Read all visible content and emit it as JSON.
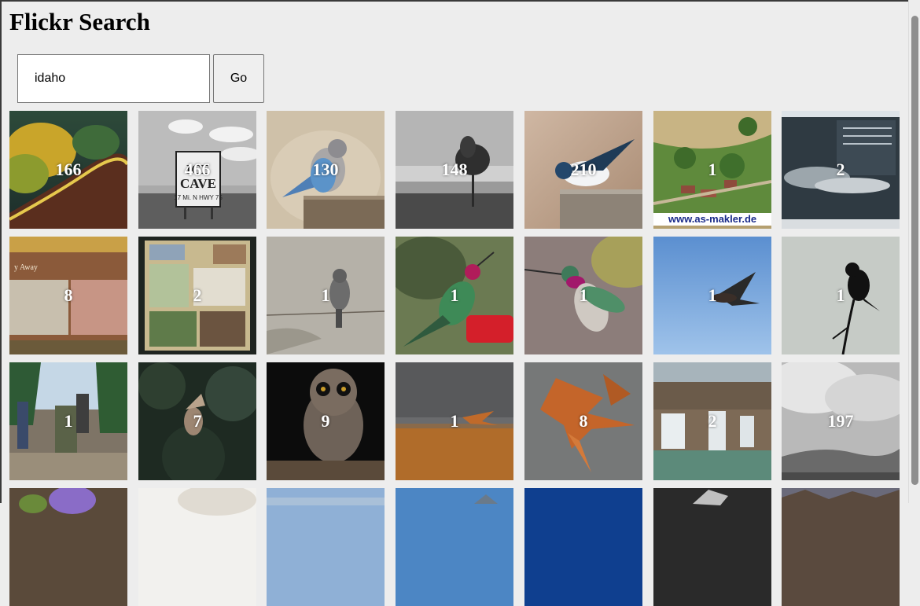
{
  "page": {
    "title": "Flickr Search"
  },
  "search": {
    "value": "idaho",
    "go_label": "Go"
  },
  "results": [
    {
      "count": "166",
      "photo": "autumn-trees-hillside"
    },
    {
      "count": "466",
      "photo": "ice-cave-sign"
    },
    {
      "count": "130",
      "photo": "bluebird-on-post"
    },
    {
      "count": "148",
      "photo": "lone-tree-monochrome"
    },
    {
      "count": "210",
      "photo": "swallow-on-post"
    },
    {
      "count": "1",
      "photo": "aerial-farm",
      "caption": "www.as-makler.de"
    },
    {
      "count": "2",
      "photo": "pass-sign"
    },
    {
      "count": "8",
      "photo": "interpretive-sign"
    },
    {
      "count": "2",
      "photo": "trail-map-board"
    },
    {
      "count": "1",
      "photo": "bird-on-wire"
    },
    {
      "count": "1",
      "photo": "hummingbird-feeder"
    },
    {
      "count": "1",
      "photo": "hummingbird-flying"
    },
    {
      "count": "1",
      "photo": "hawk-flying"
    },
    {
      "count": "1",
      "photo": "bird-silhouette"
    },
    {
      "count": "1",
      "photo": "birders-in-forest"
    },
    {
      "count": "7",
      "photo": "owl-in-trees"
    },
    {
      "count": "9",
      "photo": "owl-on-branch"
    },
    {
      "count": "1",
      "photo": "hawk-over-field"
    },
    {
      "count": "8",
      "photo": "hawks-flying"
    },
    {
      "count": "2",
      "photo": "waterfall"
    },
    {
      "count": "197",
      "photo": "clouds-monochrome"
    },
    {
      "count": "",
      "photo": "purple-flowers"
    },
    {
      "count": "",
      "photo": "light-blur"
    },
    {
      "count": "",
      "photo": "sky-landscape"
    },
    {
      "count": "",
      "photo": "mountain-sky"
    },
    {
      "count": "",
      "photo": "deep-blue-sky"
    },
    {
      "count": "",
      "photo": "dark-rocks"
    },
    {
      "count": "",
      "photo": "rocky-ridge"
    }
  ]
}
